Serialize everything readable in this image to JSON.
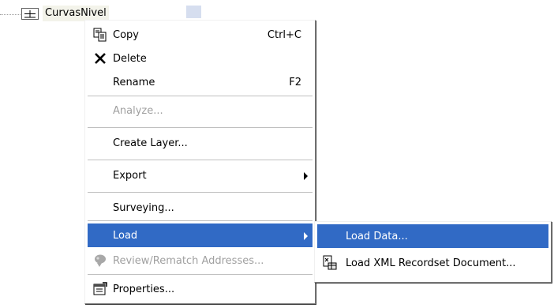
{
  "tree": {
    "node_label": "CurvasNivel",
    "icons": {
      "expander": "plus-square-icon"
    }
  },
  "menu": {
    "items": [
      {
        "label": "Copy",
        "shortcut": "Ctrl+C",
        "icon": "copy-icon"
      },
      {
        "label": "Delete",
        "shortcut": "",
        "icon": "delete-x-icon"
      },
      {
        "label": "Rename",
        "shortcut": "F2"
      },
      {
        "label": "Analyze...",
        "disabled": true
      },
      {
        "label": "Create Layer..."
      },
      {
        "label": "Export",
        "submenu": true
      },
      {
        "label": "Surveying..."
      },
      {
        "label": "Load",
        "submenu": true,
        "highlighted": true
      },
      {
        "label": "Review/Rematch Addresses...",
        "disabled": true,
        "icon": "geocode-icon"
      },
      {
        "label": "Properties...",
        "icon": "properties-icon"
      }
    ]
  },
  "submenu": {
    "items": [
      {
        "label": "Load Data...",
        "highlighted": true
      },
      {
        "label": "Load XML Recordset Document...",
        "icon": "xml-document-icon"
      }
    ]
  },
  "colors": {
    "highlight": "#316ac5",
    "disabled_text": "#a0a0a0"
  }
}
